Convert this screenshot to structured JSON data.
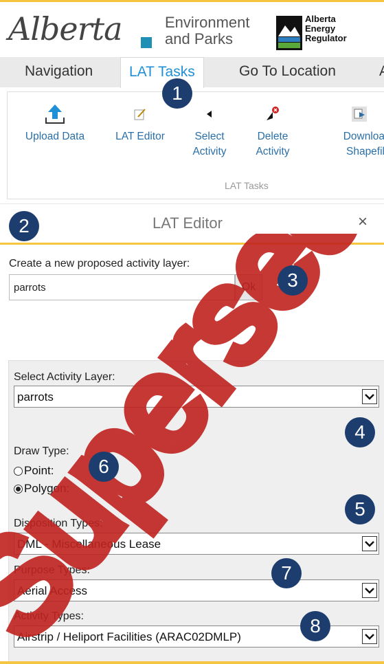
{
  "header": {
    "alberta_logo": "Alberta",
    "env_line1": "Environment",
    "env_line2": "and Parks",
    "aer_line1": "Alberta",
    "aer_line2": "Energy",
    "aer_line3": "Regulator"
  },
  "tabs": [
    {
      "label": "Navigation"
    },
    {
      "label": "LAT Tasks",
      "active": true
    },
    {
      "label": "Go To Location"
    },
    {
      "label": "A"
    }
  ],
  "ribbon": {
    "buttons": [
      {
        "label1": "Upload Data",
        "label2": "",
        "icon": "upload-icon"
      },
      {
        "label1": "LAT Editor",
        "label2": "",
        "icon": "edit-icon"
      },
      {
        "label1": "Select",
        "label2": "Activity",
        "icon": "select-arrow-icon"
      },
      {
        "label1": "Delete",
        "label2": "Activity",
        "icon": "delete-icon"
      },
      {
        "label1": "Downloa",
        "label2": "Shapefil",
        "icon": "download-icon"
      }
    ],
    "group_label": "LAT Tasks"
  },
  "badges": [
    "1",
    "2",
    "3",
    "4",
    "5",
    "6",
    "7",
    "8"
  ],
  "panel": {
    "title": "LAT Editor",
    "close": "×"
  },
  "create_layer": {
    "label": "Create a new proposed activity layer:",
    "value": "parrots",
    "ok_label": "Ok"
  },
  "settings": {
    "activity_layer_label": "Select Activity Layer:",
    "activity_layer_value": "parrots",
    "draw_type_label": "Draw Type:",
    "draw_options": [
      {
        "label": "Point:",
        "selected": false
      },
      {
        "label": "Polygon:",
        "selected": true
      }
    ],
    "disposition_label": "Disposition Types:",
    "disposition_value": "DML - Miscellaneous Lease",
    "purpose_label": "Purpose Types:",
    "purpose_value": "Aerial Access",
    "activity_types_label": "Activity Types:",
    "activity_types_value": "Airstrip / Heliport Facilities (ARAC02DMLP)"
  },
  "watermark": {
    "text": "Superseded",
    "color": "#c0231f"
  },
  "colors": {
    "accent_yellow": "#f5c542",
    "badge_navy": "#1c3d6e",
    "tab_active_blue": "#1f8fd6",
    "alberta_blue": "#1f8fb6"
  }
}
